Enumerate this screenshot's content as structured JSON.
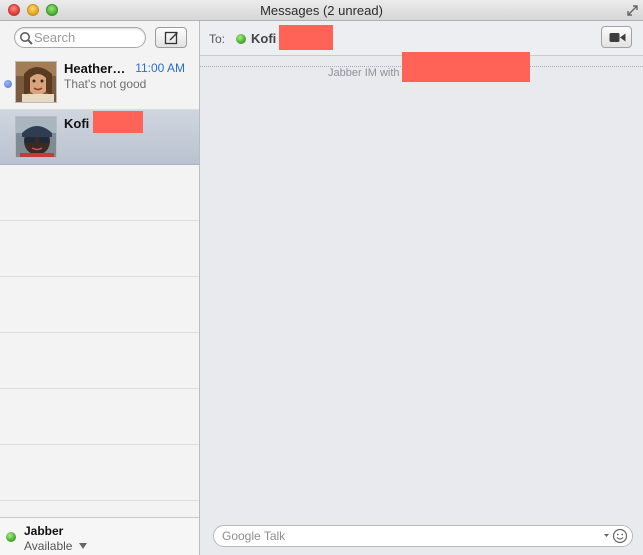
{
  "window": {
    "title": "Messages (2 unread)"
  },
  "sidebar": {
    "search": {
      "placeholder": "Search"
    },
    "conversations": [
      {
        "name": "Heather…",
        "time": "11:00 AM",
        "preview": "That's not good",
        "unread": true,
        "selected": false
      },
      {
        "name": "Kofi",
        "time": "",
        "preview": "",
        "unread": false,
        "selected": true
      }
    ],
    "footer": {
      "account": "Jabber",
      "status": "Available"
    }
  },
  "main": {
    "to_label": "To:",
    "recipient": "Kofi",
    "transcript_label": "Jabber IM with",
    "compose_placeholder": "Google Talk"
  },
  "colors": {
    "unread_dot": "#5073d0",
    "time_text": "#2c6ecb",
    "online_green": "#3fa52b",
    "redaction": "#ff6357",
    "selected_row": "#c4ccd8"
  },
  "icons": [
    "fullscreen-icon",
    "search-icon",
    "compose-icon",
    "video-camera-icon",
    "emoji-icon",
    "chevron-down-icon"
  ]
}
